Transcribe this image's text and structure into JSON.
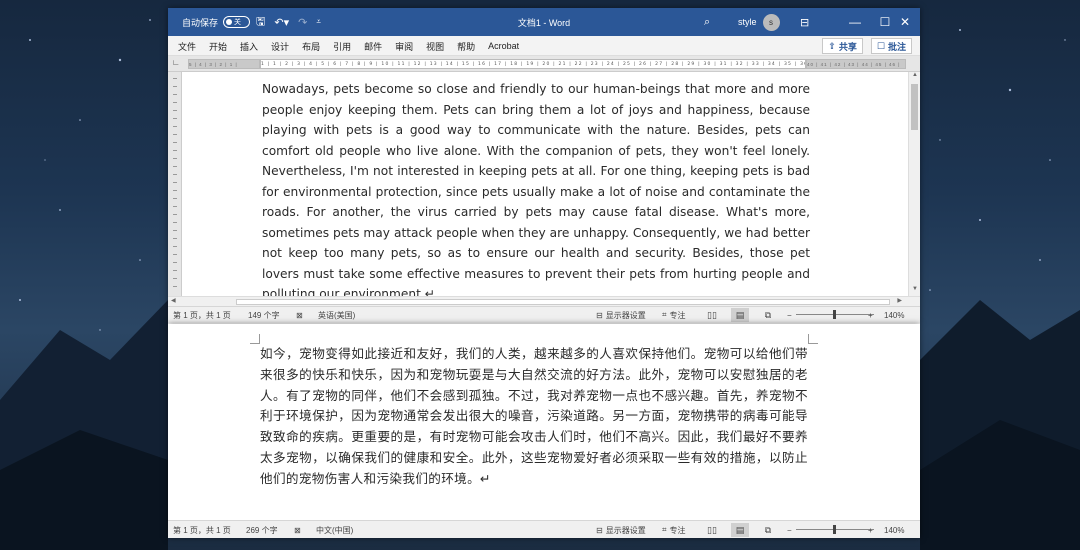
{
  "titlebar": {
    "autosave_label": "自动保存",
    "autosave_state": "关",
    "doc_title": "文档1 - Word",
    "user_name": "style",
    "user_initial": "s"
  },
  "ribbon": {
    "tabs": [
      "文件",
      "开始",
      "插入",
      "设计",
      "布局",
      "引用",
      "邮件",
      "审阅",
      "视图",
      "帮助",
      "Acrobat"
    ],
    "share_label": "共享",
    "comments_label": "批注"
  },
  "ruler": {
    "left_numbers": "5 | 4 | 3 | 2 | 1 |",
    "numbers": "1 | 1 | 2 | 3 | 4 | 5 | 6 | 7 | 8 | 9 | 10 | 11 | 12 | 13 | 14 | 15 | 16 | 17 | 18 | 19 | 20 | 21 | 22 | 23 | 24 | 25 | 26 | 27 | 28 | 29 | 30 | 31 | 32 | 33 | 34 | 35 | 36 | 37 | 38 | 39 |",
    "right_numbers": "40 | 41 | 42 | 43 | 44 | 45 | 46 |"
  },
  "doc1": {
    "text": "Nowadays, pets become so close and friendly to our human-beings that more and more people enjoy keeping them. Pets can bring them a lot of joys and happiness, because playing with pets is a good way to communicate with the nature. Besides, pets can comfort old people who live alone. With the companion of pets, they won't feel lonely. Nevertheless, I'm not interested in keeping pets at all. For one thing, keeping pets is bad for environmental protection, since pets usually make a lot of noise and contaminate the roads. For another, the virus carried by pets may cause fatal disease. What's more, sometimes pets may attack people when they are unhappy. Consequently, we had better not keep too many pets, so as to ensure our health and security. Besides, those pet lovers must take some effective measures to prevent their pets from hurting people and polluting our environment.↵"
  },
  "status1": {
    "page": "第 1 页，共 1 页",
    "words": "149 个字",
    "language": "英语(美国)",
    "display_settings": "显示器设置",
    "focus": "专注",
    "zoom": "140%"
  },
  "doc2": {
    "text": "如今，宠物变得如此接近和友好，我们的人类，越来越多的人喜欢保持他们。宠物可以给他们带来很多的快乐和快乐，因为和宠物玩耍是与大自然交流的好方法。此外，宠物可以安慰独居的老人。有了宠物的同伴，他们不会感到孤独。不过，我对养宠物一点也不感兴趣。首先，养宠物不利于环境保护，因为宠物通常会发出很大的噪音，污染道路。另一方面，宠物携带的病毒可能导致致命的疾病。更重要的是，有时宠物可能会攻击人们时，他们不高兴。因此，我们最好不要养太多宠物，以确保我们的健康和安全。此外，这些宠物爱好者必须采取一些有效的措施，以防止他们的宠物伤害人和污染我们的环境。↵"
  },
  "status2": {
    "page": "第 1 页，共 1 页",
    "words": "269 个字",
    "language": "中文(中国)",
    "display_settings": "显示器设置",
    "focus": "专注",
    "zoom": "140%"
  },
  "icons": [
    "save-icon",
    "undo-icon",
    "redo-icon",
    "customize-icon",
    "search-icon",
    "ribbon-display-icon",
    "minimize-icon",
    "maximize-icon",
    "close-icon",
    "share-icon",
    "comment-icon",
    "proofing-icon",
    "display-settings-icon",
    "focus-icon",
    "read-mode-icon",
    "print-layout-icon",
    "web-layout-icon"
  ],
  "colors": {
    "titlebar": "#2b5797",
    "accent": "#2b5797"
  }
}
